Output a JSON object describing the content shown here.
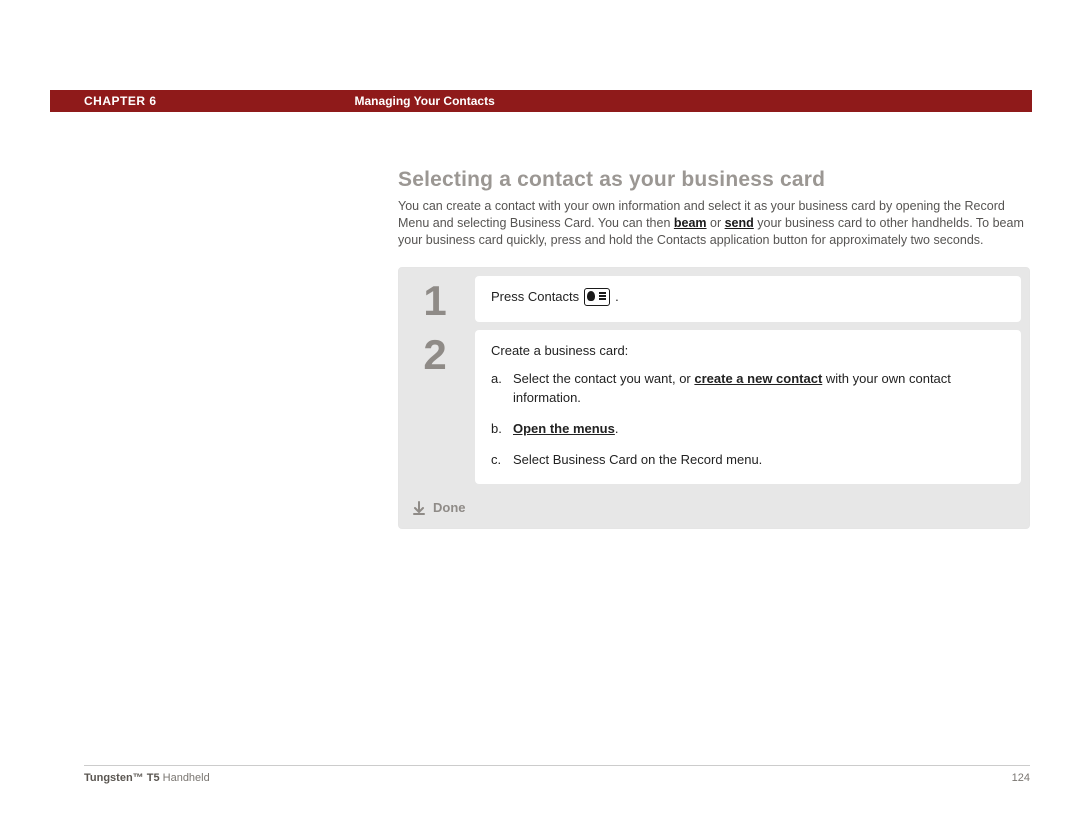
{
  "header": {
    "chapter": "CHAPTER 6",
    "title": "Managing Your Contacts"
  },
  "section": {
    "heading": "Selecting a contact as your business card",
    "intro_part1": "You can create a contact with your own information and select it as your business card by opening the Record Menu and selecting Business Card. You can then ",
    "intro_link1": "beam",
    "intro_mid": " or ",
    "intro_link2": "send",
    "intro_part2": " your business card to other handhelds. To beam your business card quickly, press and hold the Contacts application button for approximately two seconds."
  },
  "steps": [
    {
      "num": "1",
      "press_label": "Press Contacts ",
      "period": "."
    },
    {
      "num": "2",
      "lead": "Create a business card:",
      "a_letter": "a.",
      "a_text_before": "Select the contact you want, or ",
      "a_link": "create a new contact",
      "a_text_after": " with your own contact information.",
      "b_letter": "b.",
      "b_link": "Open the menus",
      "b_period": ".",
      "c_letter": "c.",
      "c_text": "Select Business Card on the Record menu."
    }
  ],
  "done_label": "Done",
  "footer": {
    "product_bold": "Tungsten™ T5",
    "product_rest": " Handheld",
    "page": "124"
  }
}
